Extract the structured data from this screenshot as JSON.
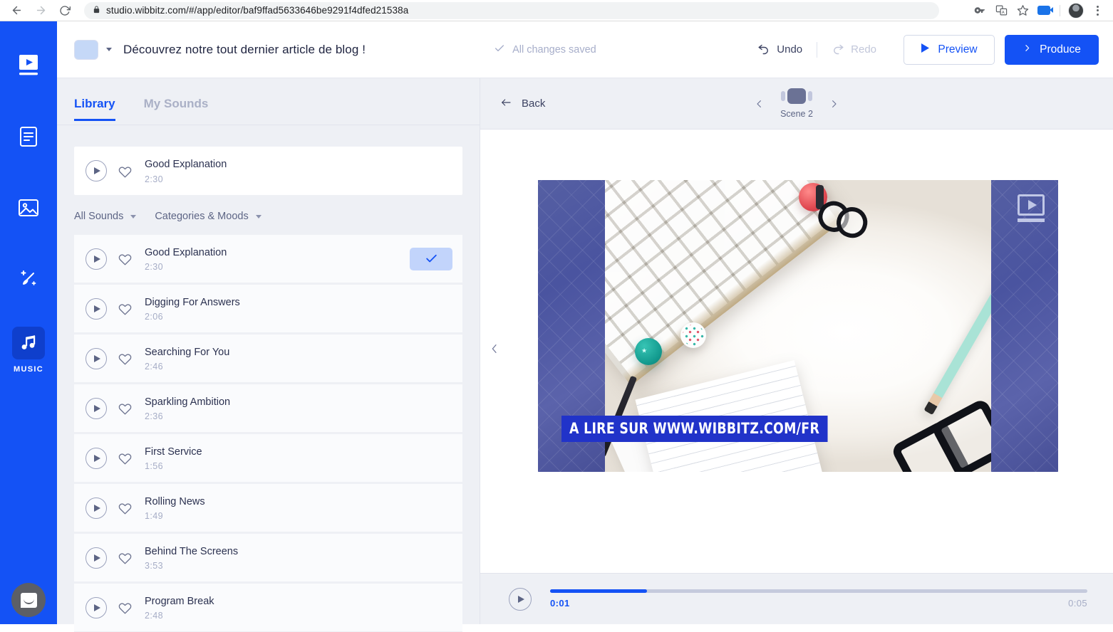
{
  "browser": {
    "url": "studio.wibbitz.com/#/app/editor/baf9ffad5633646be9291f4dfed21538a",
    "back_icon": "back-arrow-icon",
    "forward_icon": "forward-arrow-icon",
    "reload_icon": "reload-icon",
    "lock_icon": "lock-icon",
    "icons": [
      "key-icon",
      "translate-icon",
      "bookmark-star-icon",
      "video-camera-icon",
      "profile-avatar",
      "kebab-menu-icon"
    ]
  },
  "rail": {
    "items": [
      {
        "name": "video-logo",
        "icon": "video-logo-icon",
        "label": "",
        "active": false
      },
      {
        "name": "storyboard",
        "icon": "document-icon",
        "label": "",
        "active": false
      },
      {
        "name": "media",
        "icon": "image-icon",
        "label": "",
        "active": false
      },
      {
        "name": "style",
        "icon": "magic-brush-icon",
        "label": "",
        "active": false
      },
      {
        "name": "music",
        "icon": "music-note-icon",
        "label": "MUSIC",
        "active": true
      }
    ]
  },
  "topbar": {
    "swatch_color": "#c5d8f7",
    "title": "Découvrez notre tout dernier article de blog !",
    "saved_status": "All changes saved",
    "undo_label": "Undo",
    "redo_label": "Redo",
    "preview_label": "Preview",
    "produce_label": "Produce",
    "accent": "#1452f5"
  },
  "panel": {
    "tabs": [
      {
        "label": "Library",
        "active": true
      },
      {
        "label": "My Sounds",
        "active": false
      }
    ],
    "selected_track": {
      "title": "Good Explanation",
      "duration": "2:30"
    },
    "filters": [
      {
        "label": "All Sounds"
      },
      {
        "label": "Categories & Moods"
      }
    ],
    "tracks": [
      {
        "title": "Good Explanation",
        "duration": "2:30",
        "selected": true
      },
      {
        "title": "Digging For Answers",
        "duration": "2:06",
        "selected": false
      },
      {
        "title": "Searching For You",
        "duration": "2:46",
        "selected": false
      },
      {
        "title": "Sparkling Ambition",
        "duration": "2:36",
        "selected": false
      },
      {
        "title": "First Service",
        "duration": "1:56",
        "selected": false
      },
      {
        "title": "Rolling News",
        "duration": "1:49",
        "selected": false
      },
      {
        "title": "Behind The Screens",
        "duration": "3:53",
        "selected": false
      },
      {
        "title": "Program Break",
        "duration": "2:48",
        "selected": false
      }
    ]
  },
  "stage": {
    "back_label": "Back",
    "scene_label": "Scene 2",
    "caption": "A LIRE SUR WWW.WIBBITZ.COM/FR",
    "caption_bg": "#2133c9",
    "watermark": "wibbitz-logo-watermark"
  },
  "player": {
    "current_time": "0:01",
    "total_time": "0:05",
    "progress_percent": 18,
    "progress_color": "#1452f5"
  },
  "support": {
    "launcher_icon": "intercom-chat-icon"
  }
}
